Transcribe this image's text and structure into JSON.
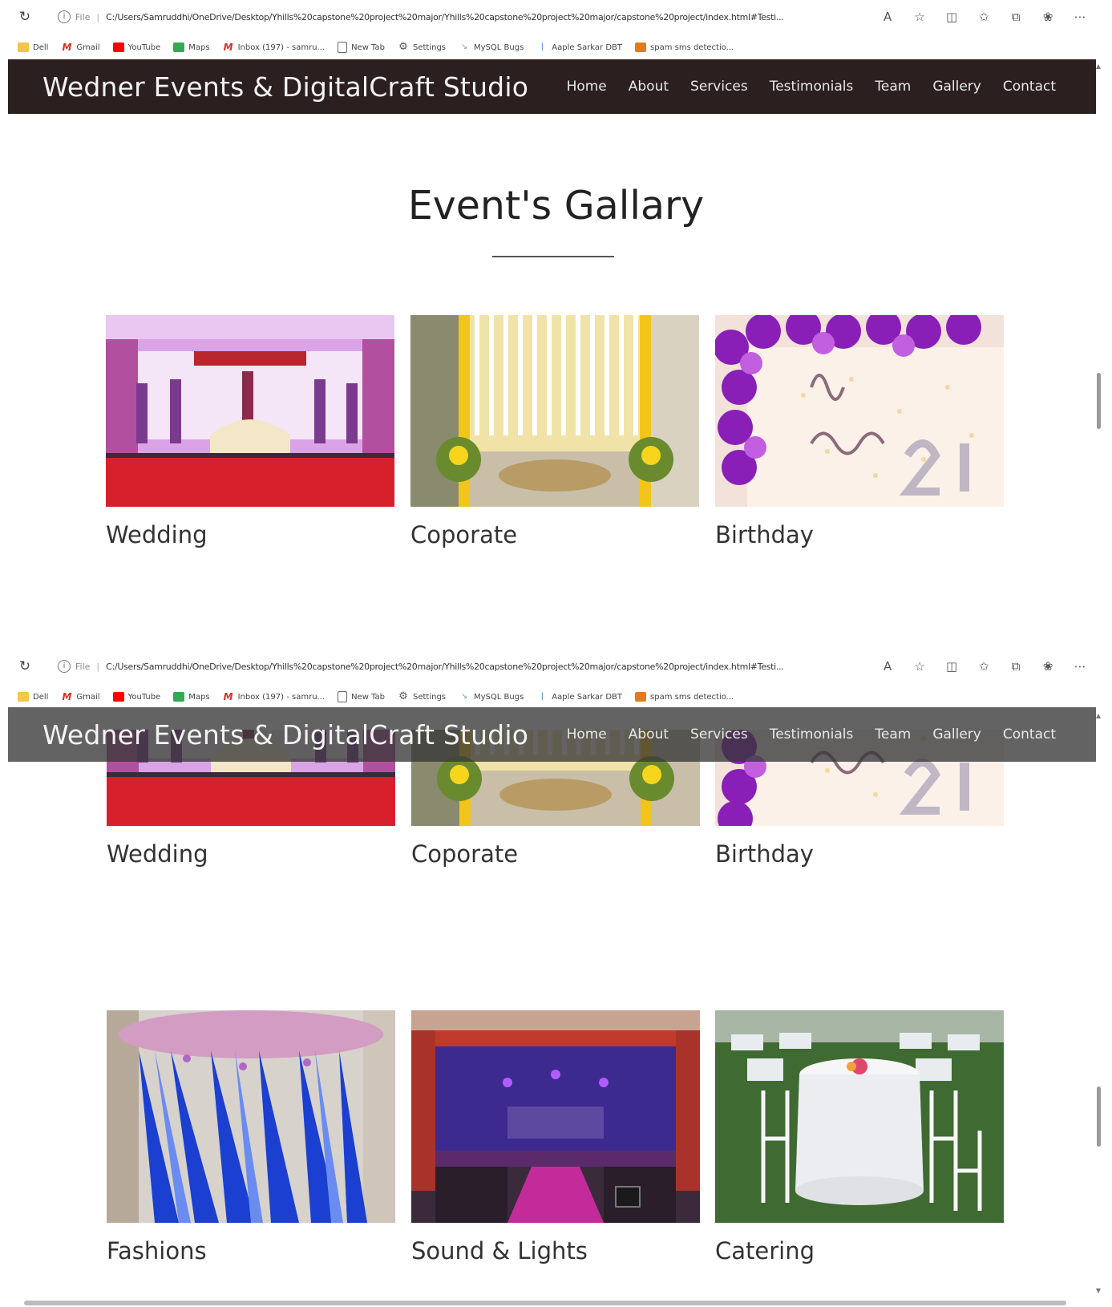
{
  "browser": {
    "file_label": "File",
    "url": "C:/Users/Samruddhi/OneDrive/Desktop/Yhills%20capstone%20project%20major/Yhills%20capstone%20project%20major/capstone%20project/index.html#Testi...",
    "bookmarks": [
      {
        "label": "Dell",
        "icon": "folder-icon"
      },
      {
        "label": "Gmail",
        "icon": "gmail-icon"
      },
      {
        "label": "YouTube",
        "icon": "youtube-icon"
      },
      {
        "label": "Maps",
        "icon": "maps-icon"
      },
      {
        "label": "Inbox (197) - samru...",
        "icon": "gmail-icon"
      },
      {
        "label": "New Tab",
        "icon": "page-icon"
      },
      {
        "label": "Settings",
        "icon": "gear-icon"
      },
      {
        "label": "MySQL Bugs",
        "icon": "bug-icon"
      },
      {
        "label": "Aaple Sarkar DBT",
        "icon": "aaple-icon"
      },
      {
        "label": "spam sms detectio...",
        "icon": "spam-icon"
      }
    ]
  },
  "site": {
    "brand": "Wedner Events & DigitalCraft Studio",
    "nav": [
      "Home",
      "About",
      "Services",
      "Testimonials",
      "Team",
      "Gallery",
      "Contact"
    ]
  },
  "gallery": {
    "title": "Event's Gallary",
    "items": [
      "Wedding",
      "Coporate",
      "Birthday",
      "Fashions",
      "Sound & Lights",
      "Catering"
    ]
  },
  "colors": {
    "navbar_solid": "#2b1f1f",
    "navbar_overlay": "#373737"
  }
}
